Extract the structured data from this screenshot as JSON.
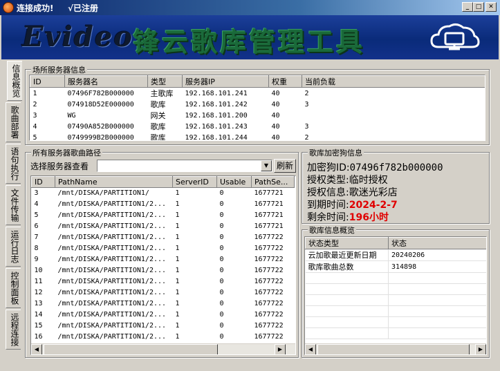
{
  "window": {
    "title": "连接成功!",
    "registered": "√已注册",
    "min": "_",
    "max": "□",
    "close": "✕"
  },
  "banner": {
    "logo": "Evideo",
    "product": "锋云歌库管理工具",
    "cloud_icon": "cloud-monitor-icon"
  },
  "tabs": [
    "信息概览",
    "歌曲部署",
    "语句执行",
    "文件传输",
    "运行日志",
    "控制面板",
    "远程连接"
  ],
  "servers_group": {
    "title": "场所服务器信息",
    "columns": [
      "ID",
      "服务器名",
      "类型",
      "服务器IP",
      "权重",
      "当前负载"
    ],
    "rows": [
      [
        "1",
        "07496F782B000000",
        "主歌库",
        "192.168.101.241",
        "40",
        "2"
      ],
      [
        "2",
        "074918D52E000000",
        "歌库",
        "192.168.101.242",
        "40",
        "3"
      ],
      [
        "3",
        "WG",
        "网关",
        "192.168.101.200",
        "40",
        ""
      ],
      [
        "4",
        "07490A852B000000",
        "歌库",
        "192.168.101.243",
        "40",
        "3"
      ],
      [
        "5",
        "0749999B2B000000",
        "歌库",
        "192.168.101.244",
        "40",
        "2"
      ]
    ]
  },
  "paths_group": {
    "title": "所有服务器歌曲路径",
    "select_label": "选择服务器查看",
    "select_value": "",
    "refresh": "刷新",
    "columns": [
      "ID",
      "PathName",
      "ServerID",
      "Usable",
      "PathSe..."
    ],
    "rows": [
      [
        "3",
        "/mnt/DISKA/PARTITION1/",
        "1",
        "0",
        "1677721"
      ],
      [
        "4",
        "/mnt/DISKA/PARTITION1/2...",
        "1",
        "0",
        "1677721"
      ],
      [
        "5",
        "/mnt/DISKA/PARTITION1/2...",
        "1",
        "0",
        "1677721"
      ],
      [
        "6",
        "/mnt/DISKA/PARTITION1/2...",
        "1",
        "0",
        "1677721"
      ],
      [
        "7",
        "/mnt/DISKA/PARTITION1/2...",
        "1",
        "0",
        "1677722"
      ],
      [
        "8",
        "/mnt/DISKA/PARTITION1/2...",
        "1",
        "0",
        "1677722"
      ],
      [
        "9",
        "/mnt/DISKA/PARTITION1/2...",
        "1",
        "0",
        "1677722"
      ],
      [
        "10",
        "/mnt/DISKA/PARTITION1/2...",
        "1",
        "0",
        "1677722"
      ],
      [
        "11",
        "/mnt/DISKA/PARTITION1/2...",
        "1",
        "0",
        "1677722"
      ],
      [
        "12",
        "/mnt/DISKA/PARTITION1/2...",
        "1",
        "0",
        "1677722"
      ],
      [
        "13",
        "/mnt/DISKA/PARTITION1/2...",
        "1",
        "0",
        "1677722"
      ],
      [
        "14",
        "/mnt/DISKA/PARTITION1/2...",
        "1",
        "0",
        "1677722"
      ],
      [
        "15",
        "/mnt/DISKA/PARTITION1/2...",
        "1",
        "0",
        "1677722"
      ],
      [
        "16",
        "/mnt/DISKA/PARTITION1/2...",
        "1",
        "0",
        "1677722"
      ]
    ]
  },
  "dongle_group": {
    "title": "歌库加密狗信息",
    "id_label": "加密狗ID:",
    "id_value": "07496f782b000000",
    "auth_type_label": "授权类型:",
    "auth_type_value": "临时授权",
    "auth_info_label": "授权信息:",
    "auth_info_value": "歌迷光彩店",
    "expire_label": "到期时间:",
    "expire_value": "2024-2-7",
    "remain_label": "剩余时间:",
    "remain_value": "196小时"
  },
  "overview_group": {
    "title": "歌库信息概览",
    "columns": [
      "状态类型",
      "状态"
    ],
    "rows": [
      [
        "云加歌最近更新日期",
        "20240206"
      ],
      [
        "歌库歌曲总数",
        "314898"
      ]
    ]
  },
  "colors": {
    "highlight_red": "#e00000",
    "banner_blue": "#0a2b7a",
    "product_green": "#1a6a3a"
  }
}
